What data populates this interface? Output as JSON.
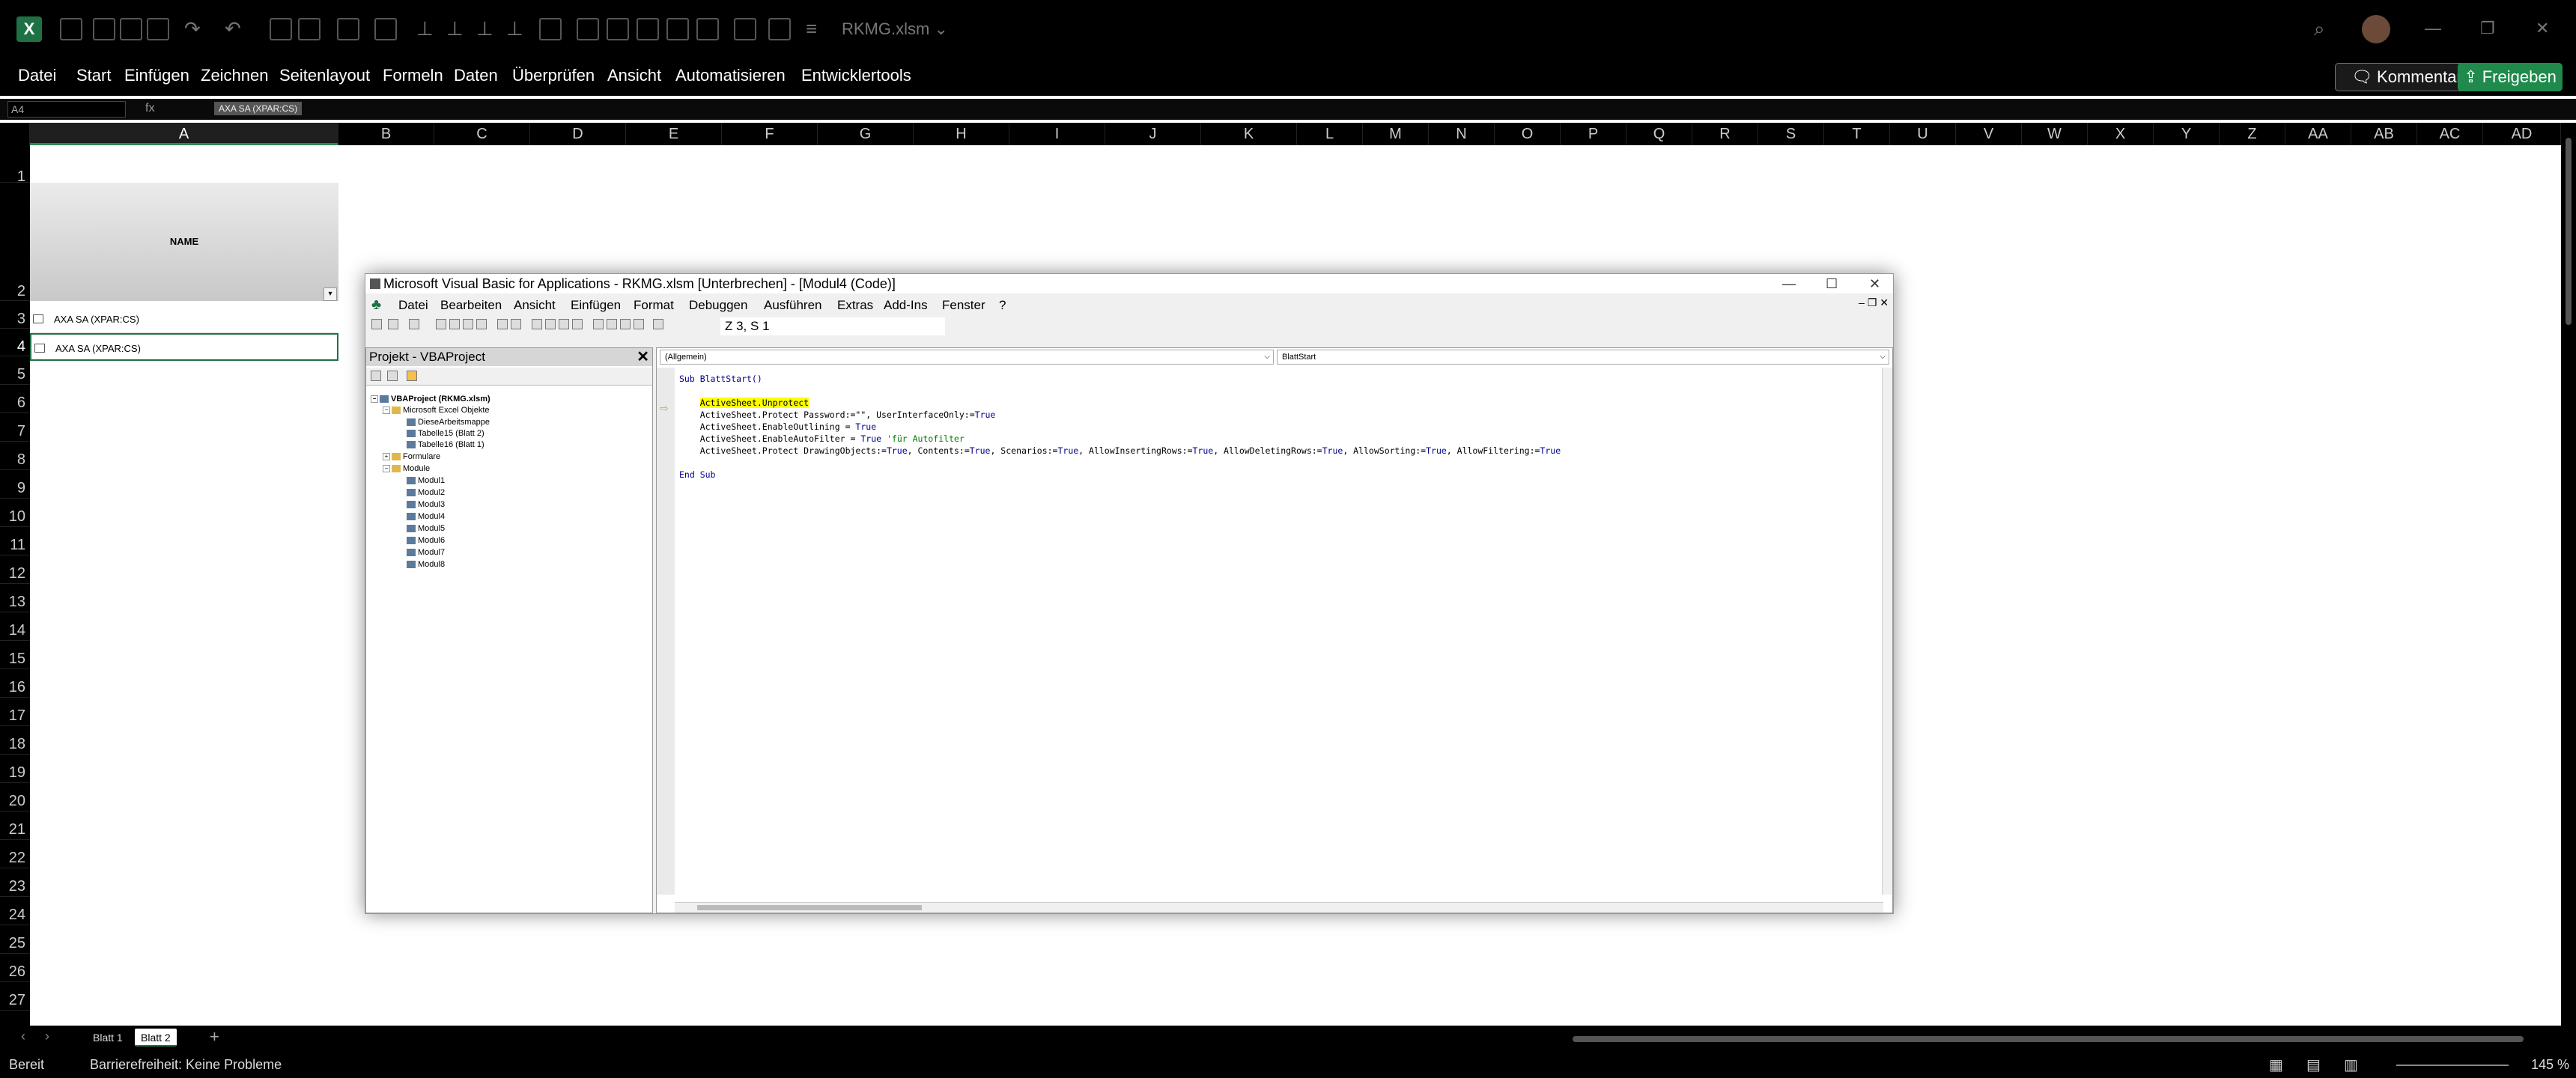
{
  "window": {
    "title": "RKMG.xlsm",
    "app_icon": "excel-icon"
  },
  "menu": [
    "Datei",
    "Start",
    "Einfügen",
    "Zeichnen",
    "Seitenlayout",
    "Formeln",
    "Daten",
    "Überprüfen",
    "Ansicht",
    "Automatisieren",
    "Entwicklertools"
  ],
  "buttons": {
    "comments": "Kommentare",
    "share": "Freigeben"
  },
  "formula_bar": {
    "name_box": "A4",
    "fx": "fx",
    "content": "AXA SA (XPAR:CS)"
  },
  "columns": [
    "A",
    "B",
    "C",
    "D",
    "E",
    "F",
    "G",
    "H",
    "I",
    "J",
    "K",
    "L",
    "M",
    "N",
    "O",
    "P",
    "Q",
    "R",
    "S",
    "T",
    "U",
    "V",
    "W",
    "X",
    "Y",
    "Z",
    "AA",
    "AB",
    "AC",
    "AD"
  ],
  "rows": [
    "1",
    "2",
    "3",
    "4",
    "5",
    "6",
    "7",
    "8",
    "9",
    "10",
    "11",
    "12",
    "13",
    "14",
    "15",
    "16",
    "17",
    "18",
    "19",
    "20",
    "21",
    "22",
    "23",
    "24",
    "25",
    "26",
    "27"
  ],
  "sheet": {
    "header": "NAME",
    "cells": [
      "AXA SA (XPAR:CS)",
      "AXA SA (XPAR:CS)"
    ]
  },
  "sheet_tabs": [
    "Blatt 1",
    "Blatt 2"
  ],
  "status": {
    "mode": "Bereit",
    "accessibility": "Barrierefreiheit: Keine Probleme",
    "zoom": "145 %"
  },
  "vbe": {
    "title": "Microsoft Visual Basic for Applications - RKMG.xlsm [Unterbrechen] - [Modul4 (Code)]",
    "menu": [
      "Datei",
      "Bearbeiten",
      "Ansicht",
      "Einfügen",
      "Format",
      "Debuggen",
      "Ausführen",
      "Extras",
      "Add-Ins",
      "Fenster",
      "?"
    ],
    "position": "Z 3, S 1",
    "project_title": "Projekt - VBAProject",
    "tree": {
      "root": "VBAProject (RKMG.xlsm)",
      "excel_objects": "Microsoft Excel Objekte",
      "workbook": "DieseArbeitsmappe",
      "sheet15": "Tabelle15 (Blatt 2)",
      "sheet16": "Tabelle16 (Blatt 1)",
      "forms": "Formulare",
      "modules": "Module",
      "module_items": [
        "Modul1",
        "Modul2",
        "Modul3",
        "Modul4",
        "Modul5",
        "Modul6",
        "Modul7",
        "Modul8"
      ]
    },
    "combo_object": "(Allgemein)",
    "combo_proc": "BlattStart",
    "code": {
      "sub_line": "Sub BlattStart()",
      "l1": "ActiveSheet.Unprotect",
      "l2a": "ActiveSheet.Protect Password:=\"\", UserInterfaceOnly:=",
      "l3a": "ActiveSheet.EnableOutlining = ",
      "l4a": "ActiveSheet.EnableAutoFilter = ",
      "l4c": "'für Autofilter",
      "l5a": "ActiveSheet.Protect DrawingObjects:=",
      "l5b": ", Contents:=",
      "l5c": ", Scenarios:=",
      "l5d": ", AllowInsertingRows:=",
      "l5e": ", AllowDeletingRows:=",
      "l5f": ", AllowSorting:=",
      "l5g": ", AllowFiltering:=",
      "true_kw": "True",
      "end_line": "End Sub"
    }
  }
}
